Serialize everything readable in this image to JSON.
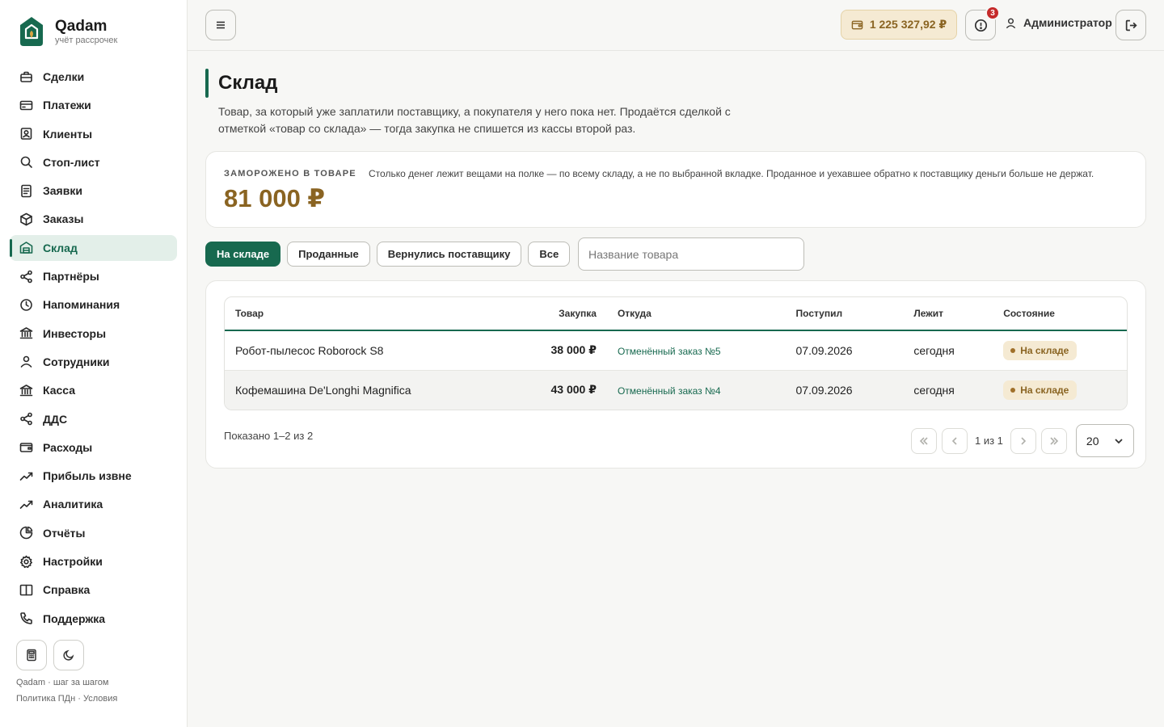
{
  "brand": {
    "name": "Qadam",
    "subtitle": "учёт рассрочек"
  },
  "sidebar": {
    "items": [
      {
        "label": "Сделки",
        "icon": "briefcase-icon",
        "active": false
      },
      {
        "label": "Платежи",
        "icon": "card-icon",
        "active": false
      },
      {
        "label": "Клиенты",
        "icon": "contact-icon",
        "active": false
      },
      {
        "label": "Стоп-лист",
        "icon": "search-icon",
        "active": false
      },
      {
        "label": "Заявки",
        "icon": "document-icon",
        "active": false
      },
      {
        "label": "Заказы",
        "icon": "box-icon",
        "active": false
      },
      {
        "label": "Склад",
        "icon": "warehouse-icon",
        "active": true
      },
      {
        "label": "Партнёры",
        "icon": "share-icon",
        "active": false
      },
      {
        "label": "Напоминания",
        "icon": "clock-icon",
        "active": false
      },
      {
        "label": "Инвесторы",
        "icon": "bank-icon",
        "active": false
      },
      {
        "label": "Сотрудники",
        "icon": "user-icon",
        "active": false
      },
      {
        "label": "Касса",
        "icon": "bank-icon",
        "active": false
      },
      {
        "label": "ДДС",
        "icon": "share-icon",
        "active": false
      },
      {
        "label": "Расходы",
        "icon": "wallet-icon",
        "active": false
      },
      {
        "label": "Прибыль извне",
        "icon": "trend-icon",
        "active": false
      },
      {
        "label": "Аналитика",
        "icon": "trend-icon",
        "active": false
      },
      {
        "label": "Отчёты",
        "icon": "pie-icon",
        "active": false
      },
      {
        "label": "Настройки",
        "icon": "gear-icon",
        "active": false
      },
      {
        "label": "Справка",
        "icon": "book-icon",
        "active": false
      },
      {
        "label": "Поддержка",
        "icon": "phone-icon",
        "active": false
      }
    ],
    "footer_line1": "Qadam · шаг за шагом",
    "footer_line2": "Политика ПДн · Условия"
  },
  "header": {
    "balance": "1 225 327,92 ₽",
    "alert_count": "3",
    "user_name": "Администратор"
  },
  "page": {
    "title": "Склад",
    "description": "Товар, за который уже заплатили поставщику, а покупателя у него пока нет. Продаётся сделкой с отметкой «товар со склада» — тогда закупка не спишется из кассы второй раз."
  },
  "frozen": {
    "label": "ЗАМОРОЖЕНО В ТОВАРЕ",
    "value": "81 000 ₽",
    "note": "Столько денег лежит вещами на полке — по всему складу, а не по выбранной вкладке. Проданное и уехавшее обратно к поставщику деньги больше не держат."
  },
  "tabs": [
    {
      "label": "На складе",
      "active": true
    },
    {
      "label": "Проданные",
      "active": false
    },
    {
      "label": "Вернулись поставщику",
      "active": false
    },
    {
      "label": "Все",
      "active": false
    }
  ],
  "search": {
    "placeholder": "Название товара",
    "value": ""
  },
  "table": {
    "headers": {
      "product": "Товар",
      "purchase": "Закупка",
      "source": "Откуда",
      "received": "Поступил",
      "lying": "Лежит",
      "status": "Состояние"
    },
    "rows": [
      {
        "product": "Робот-пылесос Roborock S8",
        "purchase": "38 000 ₽",
        "source": "Отменённый заказ №5",
        "received": "07.09.2026",
        "lying": "сегодня",
        "status": "На складе"
      },
      {
        "product": "Кофемашина De'Longhi Magnifica",
        "purchase": "43 000 ₽",
        "source": "Отменённый заказ №4",
        "received": "07.09.2026",
        "lying": "сегодня",
        "status": "На складе"
      }
    ]
  },
  "pagination": {
    "shown": "Показано 1–2 из 2",
    "page_info": "1 из 1",
    "page_size": "20"
  },
  "colors": {
    "accent": "#17694f",
    "gold": "#8a6422",
    "gold_bg": "#f5ead3"
  }
}
